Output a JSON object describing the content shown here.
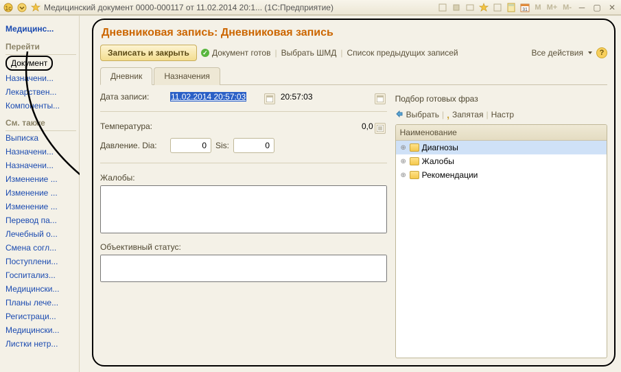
{
  "titlebar": {
    "text": "Медицинский документ 0000-000117 от 11.02.2014 20:1... (1С:Предприятие)"
  },
  "sidebar": {
    "title": "Медицинс...",
    "section1": "Перейти",
    "items1": [
      "Документ",
      "Назначени...",
      "Лекарствен...",
      "Компоненты..."
    ],
    "section2": "См. также",
    "items2": [
      "Выписка",
      "Назначени...",
      "Назначени...",
      "Изменение ...",
      "Изменение ...",
      "Изменение ...",
      "Перевод па...",
      "Лечебный о...",
      "Смена согл...",
      "Поступлени...",
      "Госпитализ...",
      "Медицински...",
      "Планы лече...",
      "Регистраци...",
      "Медицински...",
      "Листки нетр..."
    ]
  },
  "page": {
    "title": "Дневниковая запись: Дневниковая запись"
  },
  "cmdbar": {
    "save": "Записать и закрыть",
    "ready": "Документ готов",
    "choose": "Выбрать ШМД",
    "history": "Список предыдущих записей",
    "all": "Все действия"
  },
  "tabs": {
    "t0": "Дневник",
    "t1": "Назначения"
  },
  "form": {
    "date_label": "Дата записи:",
    "date_value": "11.02.2014 20:57:03",
    "time_value": "20:57:03",
    "temp_label": "Температура:",
    "temp_value": "0,0",
    "pressure_label": "Давление. Dia:",
    "dia_value": "0",
    "sis_label": "Sis:",
    "sis_value": "0",
    "complaints_label": "Жалобы:",
    "status_label": "Объективный статус:"
  },
  "side": {
    "header": "Подбор готовых фраз",
    "select": "Выбрать",
    "comma": "Запятая",
    "settings": "Настр",
    "panel_header": "Наименование",
    "tree": [
      "Диагнозы",
      "Жалобы",
      "Рекомендации"
    ]
  }
}
